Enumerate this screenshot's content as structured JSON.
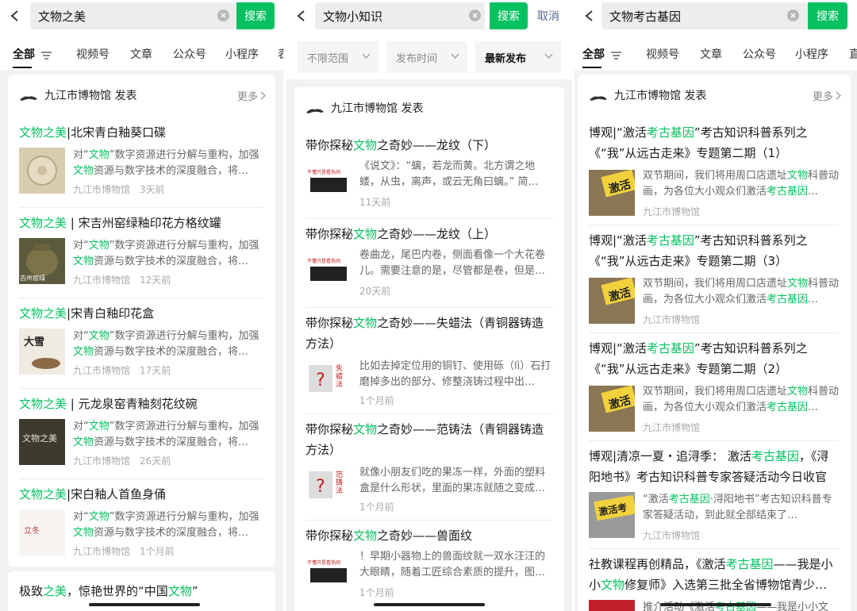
{
  "p1": {
    "query": "文物之美",
    "search_label": "搜索",
    "tabs": [
      "全部",
      "视频号",
      "文章",
      "公众号",
      "小程序",
      "表"
    ],
    "account": "九江市博物馆 发表",
    "more": "更多",
    "items": [
      {
        "pre": "",
        "hl": "文物之美",
        "post": "|北宋青白釉葵口碟",
        "source": "九江市博物馆",
        "time": "3天前"
      },
      {
        "pre": "",
        "hl": "文物之美",
        "post": " | 宋吉州窑绿釉印花方格纹罐",
        "source": "九江市博物馆",
        "time": "12天前"
      },
      {
        "pre": "",
        "hl": "文物之美",
        "post": "|宋青白釉印花盒",
        "source": "九江市博物馆",
        "time": "17天前"
      },
      {
        "pre": "",
        "hl": "文物之美",
        "post": " | 元龙泉窑青釉刻花纹碗",
        "source": "九江市博物馆",
        "time": "26天前"
      },
      {
        "pre": "",
        "hl": "文物之美",
        "post": "|宋白釉人首鱼身俑",
        "source": "九江市博物馆",
        "time": "1个月前"
      }
    ],
    "summary": {
      "a": "对“",
      "b": "文物",
      "c": "”数字资源进行分解与重构，加强",
      "d": "文物",
      "e": "资源与数字技术的深度融合，将…"
    },
    "thumb_text": {
      "t2": "古州窑绿",
      "t3": "大雪",
      "t4": "文物之美",
      "t5": "立冬"
    },
    "next": {
      "a": "极致",
      "b": "之美",
      "c": "，惊艳世界的“中国",
      "d": "文物",
      "e": "”"
    }
  },
  "p2": {
    "query": "文物小知识",
    "search_label": "搜索",
    "cancel_label": "取消",
    "filters": [
      "不限范围",
      "发布时间",
      "最新发布"
    ],
    "account": "九江市博物馆 发表",
    "items": [
      {
        "pre": "带你探秘",
        "hl": "文物",
        "post": "之奇妙——龙纹（下）",
        "summary": "《说文》：“螭，若龙而黄。北方谓之地蝼，从虫，离声，或云无角曰螭。” 简…",
        "time": "11天前",
        "thumb": "不懂只是看热闹"
      },
      {
        "pre": "带你探秘",
        "hl": "文物",
        "post": "之奇妙——龙纹（上）",
        "summary": "卷曲龙，尾巴内卷，侧面看像一个大花卷儿。需要注意的是，尽管都是卷，但是…",
        "time": "20天前",
        "thumb": "不懂只是看热闹"
      },
      {
        "pre": "带你探秘",
        "hl": "文物",
        "post": "之奇妙——失蜡法（青铜器铸造方法）",
        "summary": "比如去掉定位用的铜钉、使用砾（lì）石打磨掉多出的部分、修整浇铸过程中出…",
        "time": "1个月前",
        "thumb": "失蜡法"
      },
      {
        "pre": "带你探秘",
        "hl": "文物",
        "post": "之奇妙——范铸法（青铜器铸造方法）",
        "summary": "就像小朋友们吃的果冻一样，外面的塑料盒是什么形状，里面的果冻就随之变成…",
        "time": "1个月前",
        "thumb": "范铸法"
      },
      {
        "pre": "带你探秘",
        "hl": "文物",
        "post": "之奇妙——兽面纹",
        "summary": "！早期小器物上的兽面纹就一双水汪汪的大眼睛，随着工匠综合素质的提升，图…",
        "time": "1个月前",
        "thumb": "不懂只是看热闹"
      }
    ]
  },
  "p3": {
    "query": "文物考古基因",
    "search_label": "搜索",
    "tabs": [
      "全部",
      "视频号",
      "文章",
      "公众号",
      "小程序",
      "直"
    ],
    "account": "九江市博物馆 发表",
    "more": "更多",
    "items": [
      {
        "t1a": "博观|“激活",
        "t1b": "考古基因",
        "t1c": "”考古知识科普系列之",
        "t2": "《“我”从远古走来》专题第二期（1）",
        "sa": "双节期间，我们将用周口店遗址",
        "sb": "文物",
        "sc": "科普动画，为各位大小观众们激活",
        "sd": "考古基因",
        "se": "…",
        "source": "九江市博物馆",
        "thumb": "激活"
      },
      {
        "t1a": "博观|“激活",
        "t1b": "考古基因",
        "t1c": "”考古知识科普系列之",
        "t2": "《“我”从远古走来》专题第二期（3）",
        "sa": "双节期间，我们将用周口店遗址",
        "sb": "文物",
        "sc": "科普动画，为各位大小观众们激活",
        "sd": "考古基因",
        "se": "…",
        "source": "九江市博物馆",
        "thumb": "激活"
      },
      {
        "t1a": "博观|“激活",
        "t1b": "考古基因",
        "t1c": "”考古知识科普系列之",
        "t2": "《“我”从远古走来》专题第二期（2）",
        "sa": "双节期间，我们将用周口店遗址",
        "sb": "文物",
        "sc": "科普动画，为各位大小观众们激活",
        "sd": "考古基因",
        "se": "…",
        "source": "九江市博物馆",
        "thumb": "激活"
      },
      {
        "t1a": "博观|清凉一夏・追浔季：  激活",
        "t1b": "考古基因",
        "t1c": "，《浔",
        "t2": "阳地书》考古知识科普专家答疑活动今日收官",
        "sa": "“激活",
        "sb": "考古基因",
        "sc": "·浔阳地书”考古知识科普专家答疑活动，到此就全部结束了…",
        "sd": "",
        "se": "",
        "source": "九江市博物馆",
        "thumb": "激活考"
      }
    ],
    "last": {
      "a": "社教课程再创精品，《激活",
      "b": "考古基因",
      "c": "——我是小",
      "d": "小",
      "e": "文物",
      "f": "修复师》入选第三批全省博物馆青少…",
      "g": "推介活动《激活",
      "h": "考古基因",
      "i": "——我是小小文"
    }
  }
}
